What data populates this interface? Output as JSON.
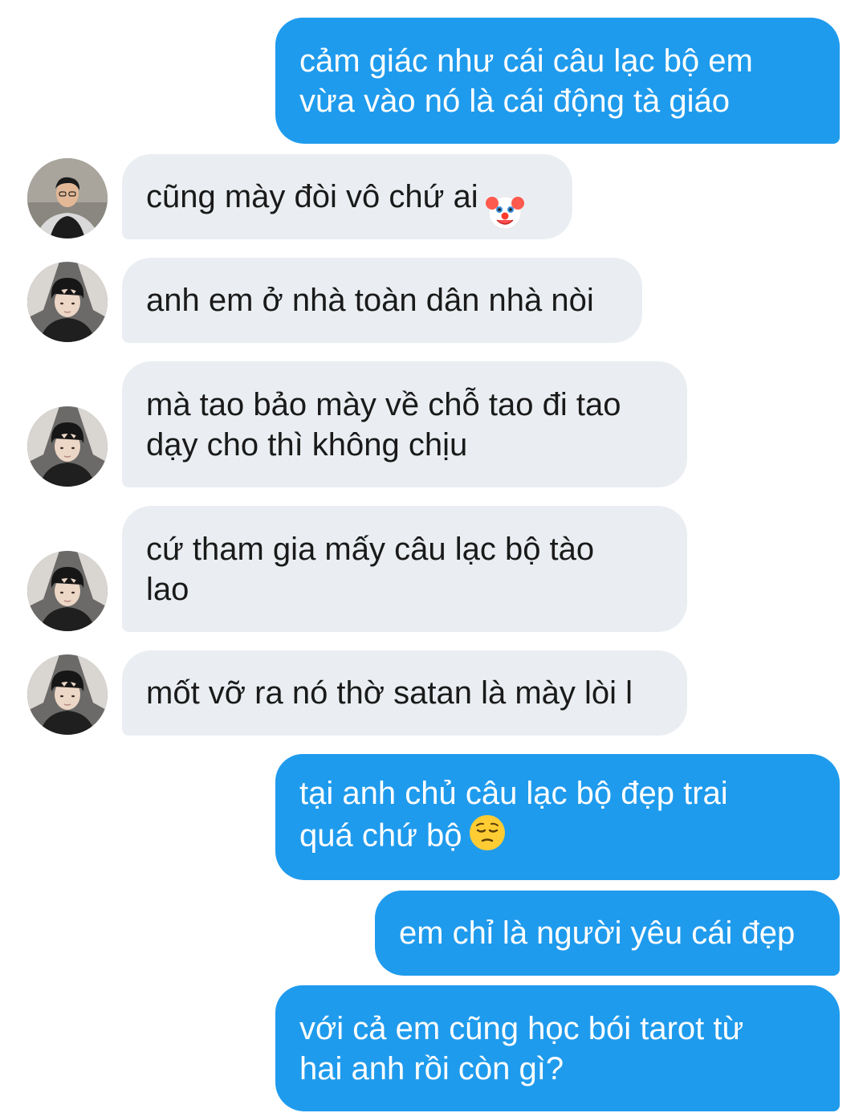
{
  "conversation": {
    "messages": [
      {
        "side": "out",
        "text": "cảm giác như cái câu lạc bộ em\nvừa vào nó là cái động tà giáo"
      },
      {
        "side": "in",
        "text": "cũng mày đòi vô chứ ai",
        "emoji": "clown-face",
        "avatar": "avatar-photo-1"
      },
      {
        "side": "in",
        "text": "anh em ở nhà toàn dân nhà nòi",
        "avatar": "avatar-photo-2"
      },
      {
        "side": "in",
        "text": "mà tao bảo mày về chỗ tao đi tao\ndạy cho thì không chịu",
        "avatar": "avatar-photo-2"
      },
      {
        "side": "in",
        "text": "cứ tham gia mấy câu lạc bộ tào\nlao",
        "avatar": "avatar-photo-2"
      },
      {
        "side": "in",
        "text": "mốt vỡ ra nó thờ satan là mày lòi l",
        "avatar": "avatar-photo-2"
      },
      {
        "side": "out",
        "text": "tại anh chủ câu lạc bộ đẹp trai\nquá chứ bộ",
        "emoji": "pensive-face"
      },
      {
        "side": "out",
        "text": "em chỉ là người yêu cái đẹp"
      },
      {
        "side": "out",
        "text": "với cả em cũng học bói tarot từ\nhai anh rồi còn gì?"
      }
    ]
  },
  "colors": {
    "outgoing_bubble": "#1f9bed",
    "incoming_bubble": "#eaeef2",
    "outgoing_text": "#ffffff",
    "incoming_text": "#1a1a1a"
  }
}
